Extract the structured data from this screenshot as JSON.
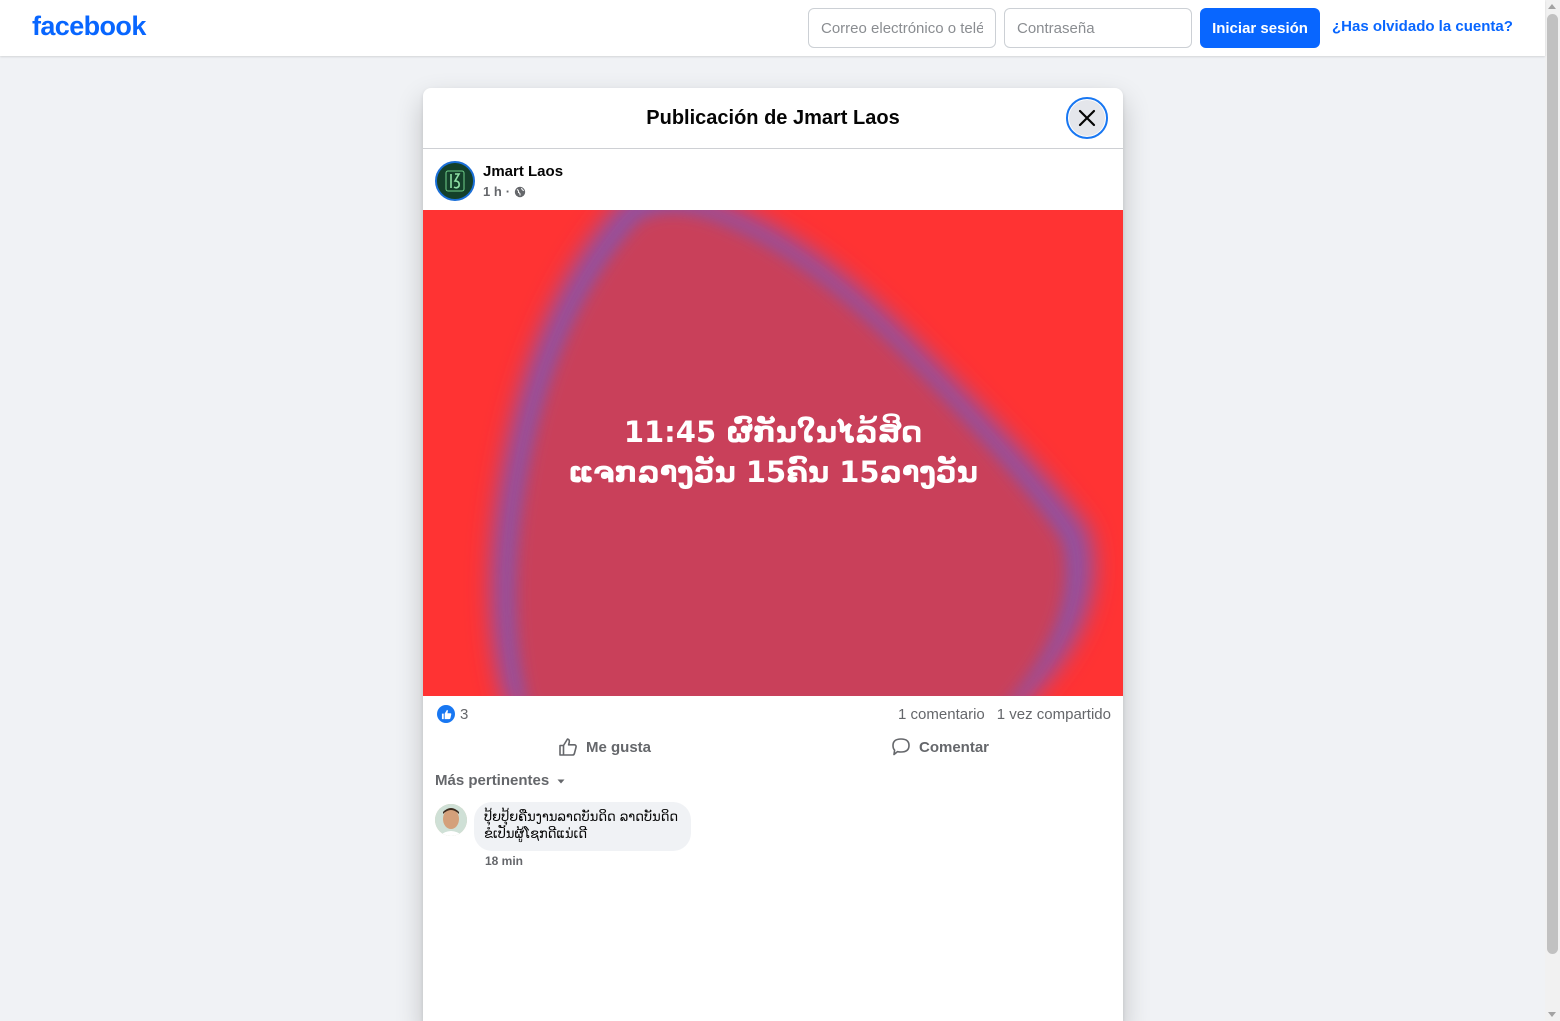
{
  "brand": {
    "logo_text": "facebook",
    "color": "#0866ff"
  },
  "login": {
    "email_placeholder": "Correo electrónico o teléfono",
    "password_placeholder": "Contraseña",
    "submit_label": "Iniciar sesión",
    "forgot_label": "¿Has olvidado la cuenta?"
  },
  "dialog": {
    "title": "Publicación de Jmart Laos",
    "close_icon": "close-icon"
  },
  "post": {
    "author": "Jmart Laos",
    "time": "1 h",
    "separator": "·",
    "audience_icon": "globe-icon",
    "image_text_line1": "11:45 ຜົກັນໃນໄລ້ສິດ",
    "image_text_line2": "ແຈກລາງວັນ 15ຄົນ 15ລາງວັນ",
    "image_colors": {
      "background": "#ff3333",
      "blob": "#c8405a"
    }
  },
  "stats": {
    "like_count": "3",
    "comments": "1 comentario",
    "shares": "1 vez compartido"
  },
  "actions": {
    "like_label": "Me gusta",
    "comment_label": "Comentar"
  },
  "comments_section": {
    "sort_label": "Más pertinentes",
    "items": [
      {
        "text": "ປຸ້ຍປຸ້ຍຄືນງານລາດບັນດິດ ລາດບັນດິດ ຂໍເປັນຜູ້ໂຊກດີແນ່ເດີ",
        "time": "18 min"
      }
    ]
  }
}
